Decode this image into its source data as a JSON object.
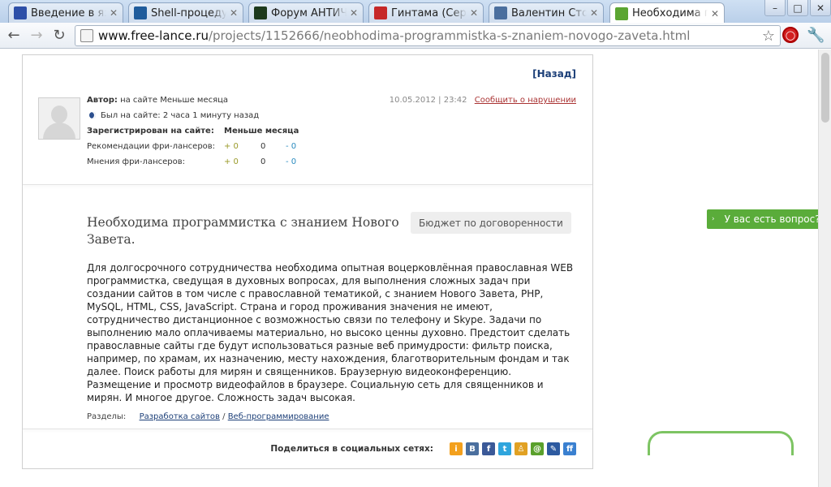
{
  "browser": {
    "tabs": [
      {
        "title": "Введение в язы",
        "favicon": "book-icon",
        "color": "#2d4fa8"
      },
      {
        "title": "Shell-процедур",
        "favicon": "lf-icon",
        "color": "#1f5c9c"
      },
      {
        "title": "Форум АНТИЧА",
        "favicon": "a-logo-icon",
        "color": "#1d3a1d"
      },
      {
        "title": "Гинтама (Сере",
        "favicon": "red-ball-icon",
        "color": "#c62828"
      },
      {
        "title": "Валентин Стол",
        "favicon": "vk-icon",
        "color": "#4b6f9e"
      },
      {
        "title": "Необходима пр",
        "favicon": "freelance-icon",
        "color": "#5ba532"
      }
    ],
    "url_host": "www.free-lance.ru",
    "url_path": "/projects/1152666/neobhodima-programmistka-s-znaniem-novogo-zaveta.html"
  },
  "page": {
    "back_link": "[Назад]",
    "author": {
      "label": "Автор:",
      "value": "на сайте Меньше месяца",
      "last_seen": "Был на сайте: 2 часа 1 минуту назад",
      "registered_label": "Зарегистрирован на сайте",
      "registered_value": "Меньше месяца",
      "stats": [
        {
          "label": "Рекомендации фри-лансеров:",
          "pos": "+ 0",
          "neu": "0",
          "neg": "- 0"
        },
        {
          "label": "Мнения фри-лансеров:",
          "pos": "+ 0",
          "neu": "0",
          "neg": "- 0"
        }
      ]
    },
    "date": "10.05.2012 | 23:42",
    "report_link": "Сообщить о нарушении",
    "project": {
      "title": "Необходима программистка с знанием Нового Завета.",
      "budget": "Бюджет по договоренности",
      "description": "Для долгосрочного сотрудничества необходима опытная воцерковлённая православная WEB программистка, сведущая в духовных вопросах, для выполнения сложных задач при создании сайтов в том числе с православной тематикой, с знанием Нового Завета, PHP, MySQL, HTML, CSS, JavaScript. Страна и город проживания значения не имеют, сотрудничество дистанционное с возможностью связи по телефону и Skype. Задачи по выполнению мало оплачиваемы материально, но высоко ценны духовно. Предстоит сделать православные сайты где будут использоваться разные веб примудрости: фильтр поиска, например, по храмам, их назначению, месту нахождения, благотворительным фондам и так далее. Поиск работы для мирян и священников. Браузерную видеоконференцию. Размещение и просмотр видеофайлов в браузере. Социальную сеть для священников и мирян. И многое другое. Сложность задач высокая."
    },
    "sections": {
      "label": "Разделы:",
      "links": [
        "Разработка сайтов",
        "Веб-программирование"
      ],
      "separator": " / "
    },
    "share_label": "Поделиться в социальных сетях:",
    "social": [
      {
        "name": "odnoklassniki-icon",
        "color": "#f3a01d",
        "glyph": "i"
      },
      {
        "name": "vkontakte-icon",
        "color": "#4b6f9e",
        "glyph": "B"
      },
      {
        "name": "facebook-icon",
        "color": "#3b5998",
        "glyph": "f"
      },
      {
        "name": "twitter-icon",
        "color": "#2fa5dd",
        "glyph": "t"
      },
      {
        "name": "moikrug-icon",
        "color": "#e1a123",
        "glyph": "♙"
      },
      {
        "name": "mailru-icon",
        "color": "#5aa02c",
        "glyph": "@"
      },
      {
        "name": "livejournal-icon",
        "color": "#2d5aa0",
        "glyph": "✎"
      },
      {
        "name": "friendfeed-icon",
        "color": "#3a80d0",
        "glyph": "ff"
      }
    ],
    "question_button": "У вас есть вопрос?"
  }
}
